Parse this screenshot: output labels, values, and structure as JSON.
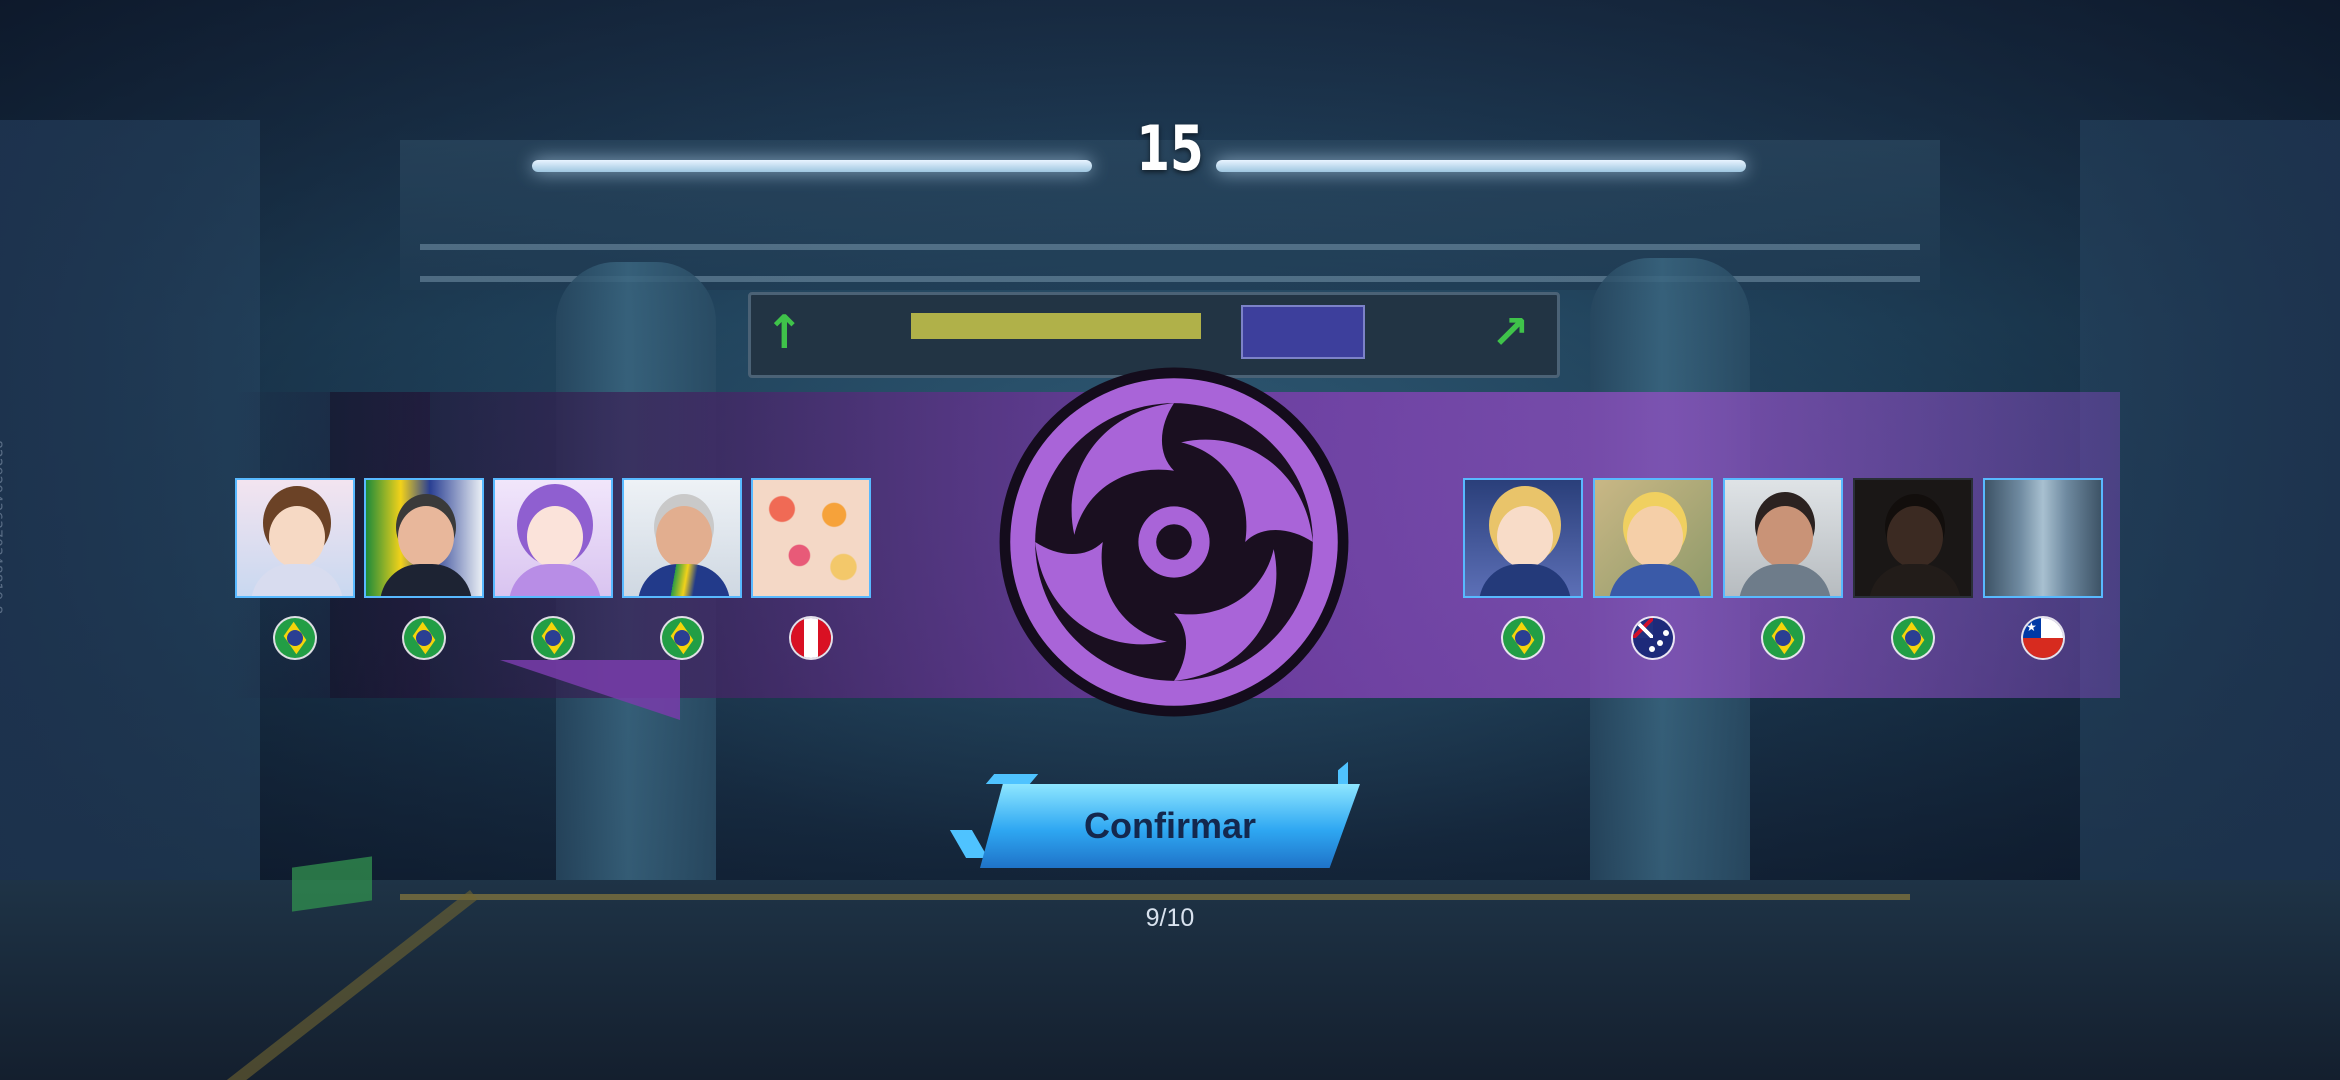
{
  "timer": {
    "seconds": "15"
  },
  "confirm": {
    "label": "Confirmar"
  },
  "progress": {
    "text": "9/10",
    "confirmed": 9,
    "total": 10
  },
  "side_id": "822929436370348819-8",
  "left_team": [
    {
      "slot": 1,
      "avatar": "chibi-boy-avatar",
      "country": "Brazil",
      "flag_icon": "flag-brazil"
    },
    {
      "slot": 2,
      "avatar": "man-with-sash-avatar",
      "country": "Brazil",
      "flag_icon": "flag-brazil"
    },
    {
      "slot": 3,
      "avatar": "chibi-girl-avatar",
      "country": "Brazil",
      "flag_icon": "flag-brazil"
    },
    {
      "slot": 4,
      "avatar": "man-with-sash-avatar",
      "country": "Brazil",
      "flag_icon": "flag-brazil"
    },
    {
      "slot": 5,
      "avatar": "food-photo-avatar",
      "country": "Peru",
      "flag_icon": "flag-peru"
    }
  ],
  "right_team": [
    {
      "slot": 1,
      "avatar": "anime-mage-avatar",
      "country": "Brazil",
      "flag_icon": "flag-brazil"
    },
    {
      "slot": 2,
      "avatar": "cartoon-money-avatar",
      "country": "Australia",
      "flag_icon": "flag-australia"
    },
    {
      "slot": 3,
      "avatar": "selfie-boy-avatar",
      "country": "Brazil",
      "flag_icon": "flag-brazil"
    },
    {
      "slot": 4,
      "avatar": "dark-selfie-avatar",
      "country": "Brazil",
      "flag_icon": "flag-brazil"
    },
    {
      "slot": 5,
      "avatar": "city-street-avatar",
      "country": "Chile",
      "flag_icon": "flag-chile"
    }
  ],
  "emblem": {
    "icon": "spiral-role-emblem-icon"
  },
  "colors": {
    "accent_blue": "#2ea7f2",
    "band_purple": "#8c50be",
    "emblem_purple": "#a964d8",
    "emblem_dark": "#1a0f20",
    "avatar_border": "#58b9ff"
  }
}
